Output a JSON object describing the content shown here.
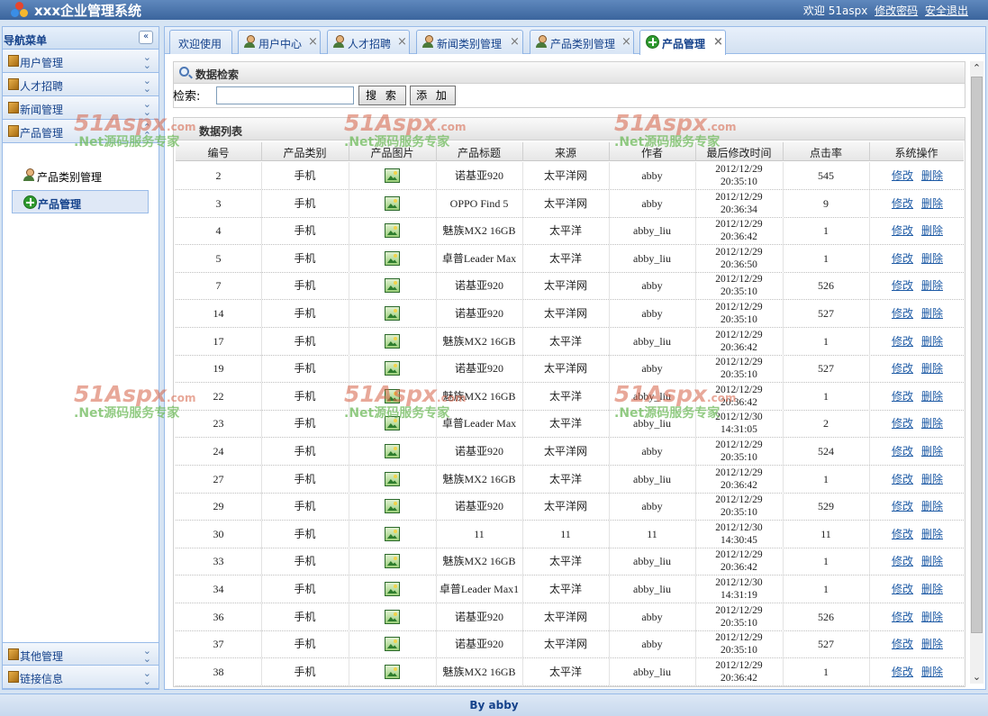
{
  "header": {
    "title": "xxx企业管理系统",
    "welcome": "欢迎 51aspx",
    "change_password": "修改密码",
    "logout": "安全退出"
  },
  "sidebar": {
    "title": "导航菜单",
    "collapse_icon": "double-chevron-left-icon",
    "groups": [
      {
        "label": "用户管理"
      },
      {
        "label": "人才招聘"
      },
      {
        "label": "新闻管理"
      },
      {
        "label": "产品管理"
      },
      {
        "label": "其他管理"
      },
      {
        "label": "链接信息"
      }
    ],
    "sub_items": [
      {
        "label": "产品类别管理",
        "icon": "user-icon"
      },
      {
        "label": "产品管理",
        "icon": "plus-icon",
        "active": true
      }
    ]
  },
  "tabs": [
    {
      "label": "欢迎使用",
      "icon": "",
      "closable": false
    },
    {
      "label": "用户中心",
      "icon": "user-icon",
      "closable": true
    },
    {
      "label": "人才招聘",
      "icon": "user-icon",
      "closable": true
    },
    {
      "label": "新闻类别管理",
      "icon": "user-icon",
      "closable": true
    },
    {
      "label": "产品类别管理",
      "icon": "user-icon",
      "closable": true
    },
    {
      "label": "产品管理",
      "icon": "plus-icon",
      "closable": true,
      "active": true
    }
  ],
  "search_panel": {
    "title": "数据检索",
    "label": "检索:",
    "input_value": "",
    "search_button": "搜 索",
    "add_button": "添 加"
  },
  "list_panel": {
    "title": "数据列表",
    "columns": [
      "编号",
      "产品类别",
      "产品图片",
      "产品标题",
      "来源",
      "作者",
      "最后修改时间",
      "点击率",
      "系统操作"
    ],
    "edit_label": "修改",
    "delete_label": "删除",
    "rows": [
      {
        "id": "2",
        "category": "手机",
        "title": "诺基亚920",
        "source": "太平洋网",
        "author": "abby",
        "date": "2012/12/29",
        "time": "20:35:10",
        "clicks": "545"
      },
      {
        "id": "3",
        "category": "手机",
        "title": "OPPO Find 5",
        "source": "太平洋网",
        "author": "abby",
        "date": "2012/12/29",
        "time": "20:36:34",
        "clicks": "9"
      },
      {
        "id": "4",
        "category": "手机",
        "title": "魅族MX2 16GB",
        "source": "太平洋",
        "author": "abby_liu",
        "date": "2012/12/29",
        "time": "20:36:42",
        "clicks": "1"
      },
      {
        "id": "5",
        "category": "手机",
        "title": "卓普Leader Max",
        "source": "太平洋",
        "author": "abby_liu",
        "date": "2012/12/29",
        "time": "20:36:50",
        "clicks": "1"
      },
      {
        "id": "7",
        "category": "手机",
        "title": "诺基亚920",
        "source": "太平洋网",
        "author": "abby",
        "date": "2012/12/29",
        "time": "20:35:10",
        "clicks": "526"
      },
      {
        "id": "14",
        "category": "手机",
        "title": "诺基亚920",
        "source": "太平洋网",
        "author": "abby",
        "date": "2012/12/29",
        "time": "20:35:10",
        "clicks": "527"
      },
      {
        "id": "17",
        "category": "手机",
        "title": "魅族MX2 16GB",
        "source": "太平洋",
        "author": "abby_liu",
        "date": "2012/12/29",
        "time": "20:36:42",
        "clicks": "1"
      },
      {
        "id": "19",
        "category": "手机",
        "title": "诺基亚920",
        "source": "太平洋网",
        "author": "abby",
        "date": "2012/12/29",
        "time": "20:35:10",
        "clicks": "527"
      },
      {
        "id": "22",
        "category": "手机",
        "title": "魅族MX2 16GB",
        "source": "太平洋",
        "author": "abby_liu",
        "date": "2012/12/29",
        "time": "20:36:42",
        "clicks": "1"
      },
      {
        "id": "23",
        "category": "手机",
        "title": "卓普Leader Max",
        "source": "太平洋",
        "author": "abby_liu",
        "date": "2012/12/30",
        "time": "14:31:05",
        "clicks": "2"
      },
      {
        "id": "24",
        "category": "手机",
        "title": "诺基亚920",
        "source": "太平洋网",
        "author": "abby",
        "date": "2012/12/29",
        "time": "20:35:10",
        "clicks": "524"
      },
      {
        "id": "27",
        "category": "手机",
        "title": "魅族MX2 16GB",
        "source": "太平洋",
        "author": "abby_liu",
        "date": "2012/12/29",
        "time": "20:36:42",
        "clicks": "1"
      },
      {
        "id": "29",
        "category": "手机",
        "title": "诺基亚920",
        "source": "太平洋网",
        "author": "abby",
        "date": "2012/12/29",
        "time": "20:35:10",
        "clicks": "529"
      },
      {
        "id": "30",
        "category": "手机",
        "title": "11",
        "source": "11",
        "author": "11",
        "date": "2012/12/30",
        "time": "14:30:45",
        "clicks": "11"
      },
      {
        "id": "33",
        "category": "手机",
        "title": "魅族MX2 16GB",
        "source": "太平洋",
        "author": "abby_liu",
        "date": "2012/12/29",
        "time": "20:36:42",
        "clicks": "1"
      },
      {
        "id": "34",
        "category": "手机",
        "title": "卓普Leader Max1",
        "source": "太平洋",
        "author": "abby_liu",
        "date": "2012/12/30",
        "time": "14:31:19",
        "clicks": "1"
      },
      {
        "id": "36",
        "category": "手机",
        "title": "诺基亚920",
        "source": "太平洋网",
        "author": "abby",
        "date": "2012/12/29",
        "time": "20:35:10",
        "clicks": "526"
      },
      {
        "id": "37",
        "category": "手机",
        "title": "诺基亚920",
        "source": "太平洋网",
        "author": "abby",
        "date": "2012/12/29",
        "time": "20:35:10",
        "clicks": "527"
      },
      {
        "id": "38",
        "category": "手机",
        "title": "魅族MX2 16GB",
        "source": "太平洋",
        "author": "abby_liu",
        "date": "2012/12/29",
        "time": "20:36:42",
        "clicks": "1"
      }
    ]
  },
  "watermark": {
    "brand": "51Aspx",
    "brand_suffix": ".com",
    "slogan": ".Net源码服务专家"
  },
  "footer": {
    "text": "By abby"
  },
  "colors": {
    "header_bg": "#3b659d",
    "panel_border": "#99bbe8",
    "link": "#1d5aa5",
    "title_text": "#15428b"
  }
}
